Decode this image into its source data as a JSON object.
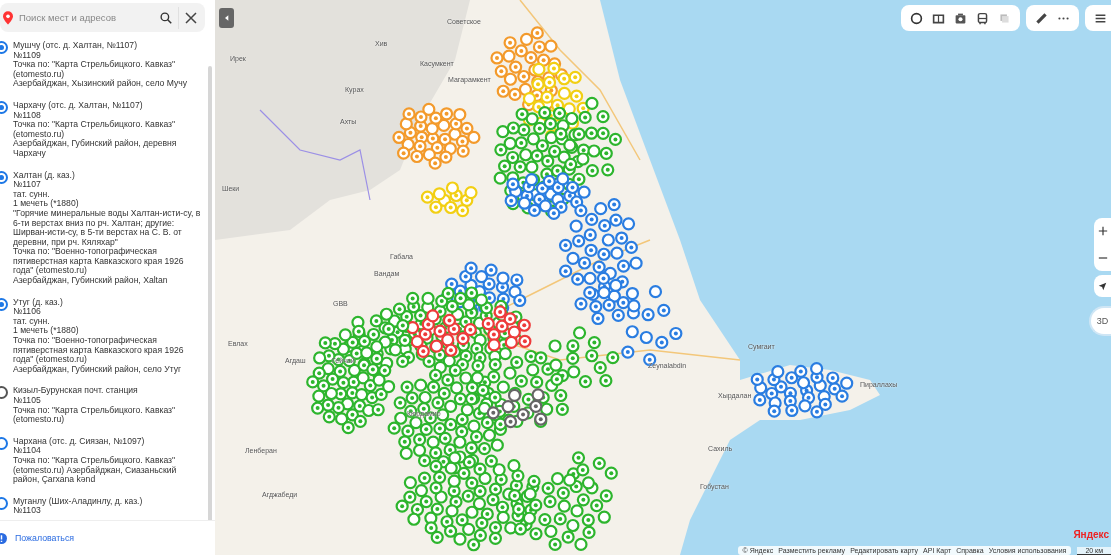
{
  "search": {
    "placeholder": "Поиск мест и адресов"
  },
  "results": [
    {
      "dot": true,
      "color": "#1e78e6",
      "lines": [
        "Мушчу (отс. д. Халтан, №1107)",
        "№1109",
        "Точка по: \"Карта Стрельбицкого. Кавказ\" (etomesto.ru)",
        "Азербайджан, Хызинский район, село Мучу"
      ]
    },
    {
      "dot": true,
      "color": "#1e78e6",
      "lines": [
        "Чархачу (отс. д. Халтан, №1107)",
        "№1108",
        "Точка по: \"Карта Стрельбицкого. Кавказ\" (etomesto.ru)",
        "Азербайджан, Губинский район, деревня Чархачу"
      ]
    },
    {
      "dot": true,
      "color": "#1e78e6",
      "lines": [
        "Халтан (д. каз.)",
        "№1107",
        "тат. сунн.",
        "1 мечеть (*1880)",
        "\"Горячие минеральные воды Халтан-исти-су, в 6-ти верстах вниз по рч. Халтан; другие: Ширван-исти-су, в 5-ти верстах на С. В. от деревни, при рч. Кяляхар\"",
        "Точка по: \"Военно-топографическая пятиверстная карта Кавказского края 1926 года\" (etomesto.ru)",
        "Азербайджан, Губинский район, Xaltan"
      ]
    },
    {
      "dot": true,
      "color": "#1e78e6",
      "lines": [
        "Утуг (д. каз.)",
        "№1106",
        "тат. сунн.",
        "1 мечеть (*1880)",
        "Точка по: \"Военно-топографическая пятиверстная карта Кавказского края 1926 года\" (etomesto.ru)",
        "Азербайджан, Губинский район, село Утуг"
      ]
    },
    {
      "dot": false,
      "color": "#555555",
      "lines": [
        "Кизыл-Бурунская почт. станция",
        "№1105",
        "Точка по: \"Карта Стрельбицкого. Кавказ\" (etomesto.ru)"
      ]
    },
    {
      "dot": false,
      "color": "#1e78e6",
      "lines": [
        "Чархана (отс. д. Сиязан, №1097)",
        "№1104",
        "Точка по: \"Карта Стрельбицкого. Кавказ\" (etomesto.ru) Азербайджан, Сиазаньский район, Çarxana kənd"
      ]
    },
    {
      "dot": false,
      "color": "#1e78e6",
      "lines": [
        "Муганлу (Ших-Аладинлу, д. каз.)",
        "№1103"
      ]
    }
  ],
  "complain_link": "Пожаловаться",
  "map_labels": [
    "Хив",
    "Советское",
    "Касумкент",
    "Магарамкент",
    "Курах",
    "Ахты",
    "Ирек",
    "Шеки",
    "Габала",
    "Вандам",
    "GBB",
    "Евлах",
    "Агдаш",
    "Гейчай",
    "Кюрдамир",
    "Ленберан",
    "Агджабеди",
    "Zeynalabdin",
    "Сумгаит",
    "Хырдалан",
    "Пираллахы",
    "Сахиль",
    "Гобустан"
  ],
  "footer_links": [
    "© Яндекс",
    "Разместить рекламу",
    "Редактировать карту",
    "API Карт",
    "Справка",
    "Условия использования"
  ],
  "scale": "20 км",
  "logo": "Яндекс",
  "view_3d": "3D"
}
